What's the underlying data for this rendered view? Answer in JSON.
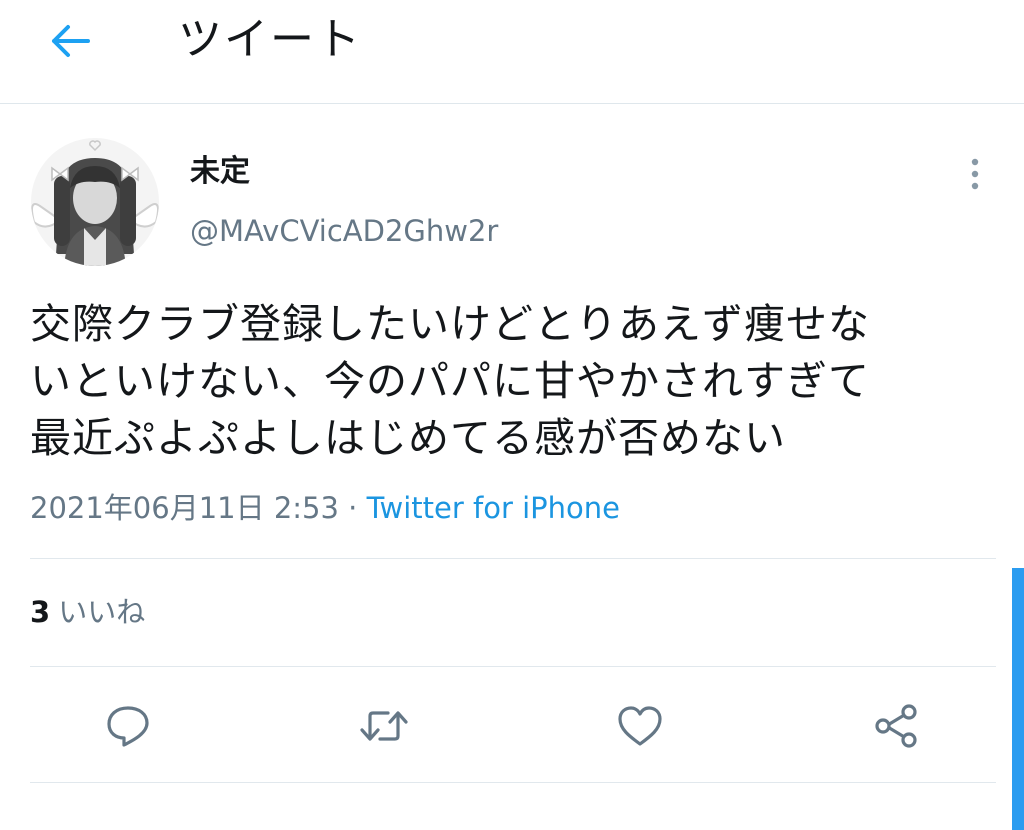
{
  "header": {
    "title": "ツイート",
    "back_icon": "arrow-left-icon"
  },
  "author": {
    "display_name": "未定",
    "handle": "@MAvCVicAD2Ghw2r"
  },
  "tweet": {
    "text": "交際クラブ登録したいけどとりあえず痩せな\nいといけない、今のパパに甘やかされすぎて\n最近ぷよぷよしはじめてる感が否めない",
    "timestamp": "2021年06月11日 2:53",
    "separator": " · ",
    "source": "Twitter for iPhone"
  },
  "stats": {
    "likes_count": "3",
    "likes_label": "いいね"
  },
  "actions": {
    "reply_icon": "reply-icon",
    "retweet_icon": "retweet-icon",
    "like_icon": "heart-icon",
    "share_icon": "share-icon"
  },
  "colors": {
    "accent": "#1da1f2",
    "link": "#1b95e0",
    "secondary_text": "#657786",
    "icon": "#657786",
    "divider": "#e1e8ed"
  }
}
